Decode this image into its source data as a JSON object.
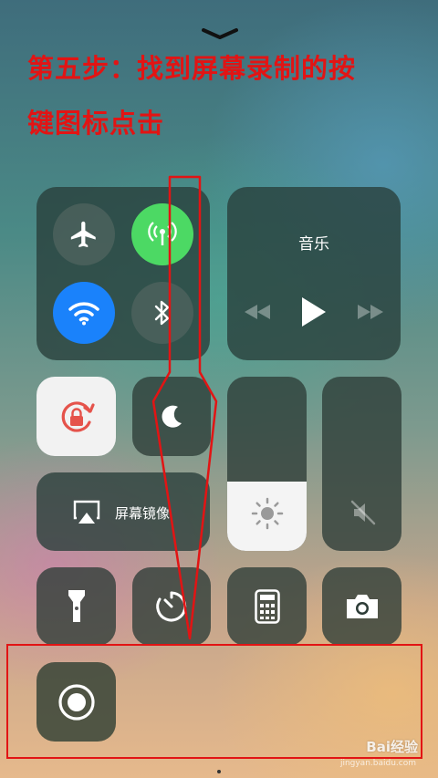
{
  "instructions": {
    "line1": "第五步：找到屏幕录制的按",
    "line2": "键图标点击"
  },
  "music": {
    "title": "音乐"
  },
  "screen_mirroring": {
    "label": "屏幕镜像"
  },
  "brightness": {
    "level_percent": 40
  },
  "volume": {
    "level_percent": 0,
    "muted": true
  },
  "connectivity": {
    "airplane_mode": false,
    "cellular_data": true,
    "wifi": true,
    "bluetooth": false
  },
  "watermark": {
    "brand": "Bai经验",
    "url": "jingyan.baidu.com"
  },
  "colors": {
    "annotation_red": "#e21414",
    "cellular_green": "#4cd964",
    "wifi_blue": "#1a82fb",
    "lock_red": "#e5534b"
  },
  "icons": [
    "chevron-down-icon",
    "airplane-icon",
    "cellular-icon",
    "wifi-icon",
    "bluetooth-icon",
    "rewind-icon",
    "play-icon",
    "fast-forward-icon",
    "rotation-lock-icon",
    "moon-icon",
    "airplay-icon",
    "sun-icon",
    "mute-icon",
    "flashlight-icon",
    "timer-icon",
    "calculator-icon",
    "camera-icon",
    "screen-record-icon"
  ]
}
